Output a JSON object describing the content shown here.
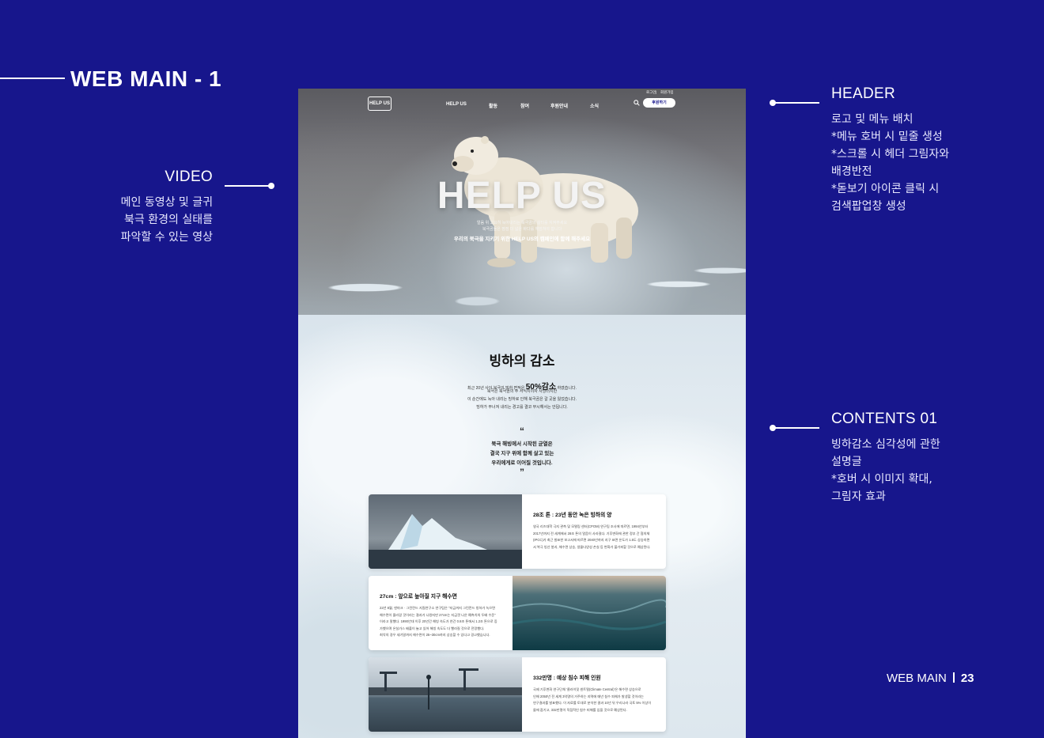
{
  "page": {
    "title": "WEB MAIN - 1",
    "footer_label": "WEB MAIN",
    "page_number": "23"
  },
  "annotations": {
    "video": {
      "heading": "VIDEO",
      "lines": [
        "메인 동영상 및 글귀",
        "북극 환경의 실태를",
        "파악할 수 있는 영상"
      ]
    },
    "header": {
      "heading": "HEADER",
      "lines": [
        "로고 및 메뉴 배치",
        "*메뉴 호버 시 밑줄 생성",
        "*스크롤 시 헤더 그림자와",
        "배경반전",
        "*돋보기 아이콘 클릭 시",
        "검색팝업창 생성"
      ]
    },
    "contents": {
      "heading": "CONTENTS 01",
      "lines": [
        "빙하감소 심각성에 관한",
        "설명글",
        "*호버 시 이미지 확대,",
        "그림자 효과"
      ]
    }
  },
  "site": {
    "logo": "HELP US",
    "nav": [
      "HELP US",
      "활동",
      "참여",
      "후원안내",
      "소식"
    ],
    "util": [
      "로그인",
      "회원가입"
    ],
    "donate_button": "후원하기",
    "hero_title": "HELP US",
    "hero_sub": [
      "얼음 위 고요히 녹아내리는 북극곰의 삶터를 지켜주세요",
      "북극곰들은 점점 더 넓은 바다를 헤엄쳐야 합니다"
    ],
    "hero_strong": "우리의 북극을 지키기 위한 HELP US의 캠페인에 함께 해주세요",
    "section_title": "빙하의 감소",
    "section_lines": {
      "line1_pre": "최근 20년 사이 북극의 빙하 면적은",
      "line1_strong": "50%감소",
      "line1_post": "하였습니다.",
      "line2": "북극은 북극곰의 주 서식지이자 사냥터지만",
      "line3": "이 순간에도 녹아 내리는 빙하로 인해 북극곰은 갈 곳을 잃었습니다.",
      "line4": "빙하가 무너져 내리는 경고를 결코 무시해서는 안됩니다."
    },
    "quote_open": "“",
    "quote_close": "”",
    "quote": [
      "북극 해빙에서 시작된 균열은",
      "결국 지구 위에 함께 살고 있는",
      "우리에게로 이어질 것입니다."
    ],
    "cards": [
      {
        "title": "28조 톤 : 23년 동안 녹은 빙하의 양",
        "body": [
          "영국 리즈대학 극지 관측 및 모델링 센터(CPOM) 연구팀 조사에 따르면, 1994년부터",
          "2017년까지 전 세계에서 28조 톤의 얼음이 사라졌다. 기후변화에 관한 정부 간 협의체",
          "(IPCC)가 최근 발표한 보고서에 따르면 2040년까지 지구 표면 온도가 1.5도 상승하면",
          "서 북극 빙산 붕괴, 해수면 상승, 생물다양성 손실 등 변화가 불가피할 것으로 예상된다."
        ]
      },
      {
        "title": "27cm : 앞으로 높아질 지구 해수면",
        "body": [
          "22년 8월, 덴마크 · 그린란드 지질연구소 연구팀은 \"지금까지 그린란드 빙하가 녹으면",
          "해수면이 올라갈 것이라는 결과가 나왔지만 27cm는 지금껏 나온 예측치의 두배 수준\"",
          "이라고 말했다. 1990년대 이후 20년간 해빙 속도가 연간 0.8조 톤에서 1.2조 톤으로 증",
          "가했으며 온실가스 배출이 늘고 있어 해빙 속도도 더 빨라질 것으로 전망했다.",
          "최악의 경우 세기말까지 해수면이 25~30cm까지 상승할 수 있다고 경고했습니다."
        ]
      },
      {
        "title": "332만명 : 예상 침수 피해 인원",
        "body": [
          "국제 기후변화 연구단체 '클라이밋 센트럴(Climate Central)'은 해수면 상승으로",
          "인해 2050년 전 세계 3억명의 거주하는 지역에 매년 침수 피해가 발생할 것이라는",
          "연구결과를 발표했다. 이 자료를 토대로 분석한 결과 10년 뒤 우리나라 국토 5% 이상이",
          "물에 잠기고, 332만명이 직접적인 침수 피해를 입을 것으로 예상된다."
        ]
      }
    ]
  }
}
